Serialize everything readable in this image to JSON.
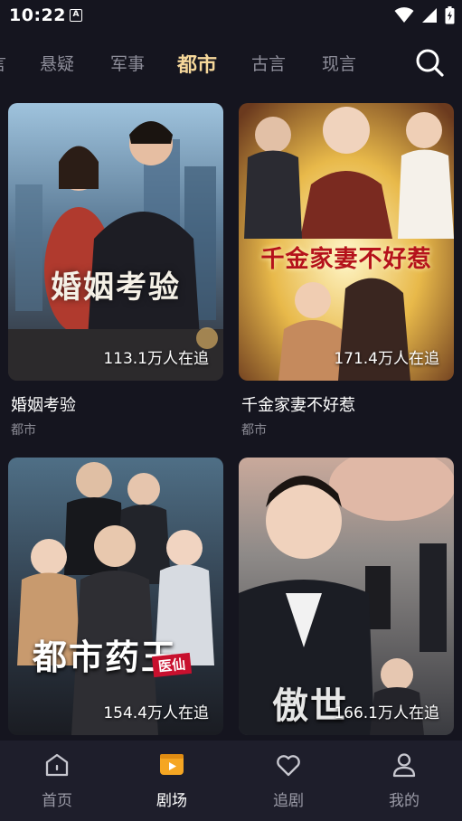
{
  "status": {
    "time": "10:22",
    "notification_glyph": "A"
  },
  "tabs": [
    {
      "label": "悬疑",
      "active": false
    },
    {
      "label": "军事",
      "active": false
    },
    {
      "label": "都市",
      "active": true
    },
    {
      "label": "古言",
      "active": false
    },
    {
      "label": "现言",
      "active": false
    }
  ],
  "tab_partial": "言",
  "cards": [
    {
      "title": "婚姻考验",
      "genre": "都市",
      "views": "113.1万人在追",
      "poster_text": "婚姻考验"
    },
    {
      "title": "千金家妻不好惹",
      "genre": "都市",
      "views": "171.4万人在追",
      "poster_text": "千金家妻不好惹"
    },
    {
      "title": "",
      "genre": "",
      "views": "154.4万人在追",
      "poster_text": "都市药王",
      "poster_badge": "医仙"
    },
    {
      "title": "",
      "genre": "",
      "views": "166.1万人在追",
      "poster_text": "傲世"
    }
  ],
  "nav": [
    {
      "label": "首页",
      "icon": "home-icon",
      "active": false
    },
    {
      "label": "剧场",
      "icon": "theater-play-icon",
      "active": true
    },
    {
      "label": "追剧",
      "icon": "heart-icon",
      "active": false
    },
    {
      "label": "我的",
      "icon": "profile-icon",
      "active": false
    }
  ],
  "colors": {
    "accent": "#f5d79a",
    "background": "#15151f",
    "nav_background": "#1e1e2b",
    "play_orange": "#f5a623"
  }
}
